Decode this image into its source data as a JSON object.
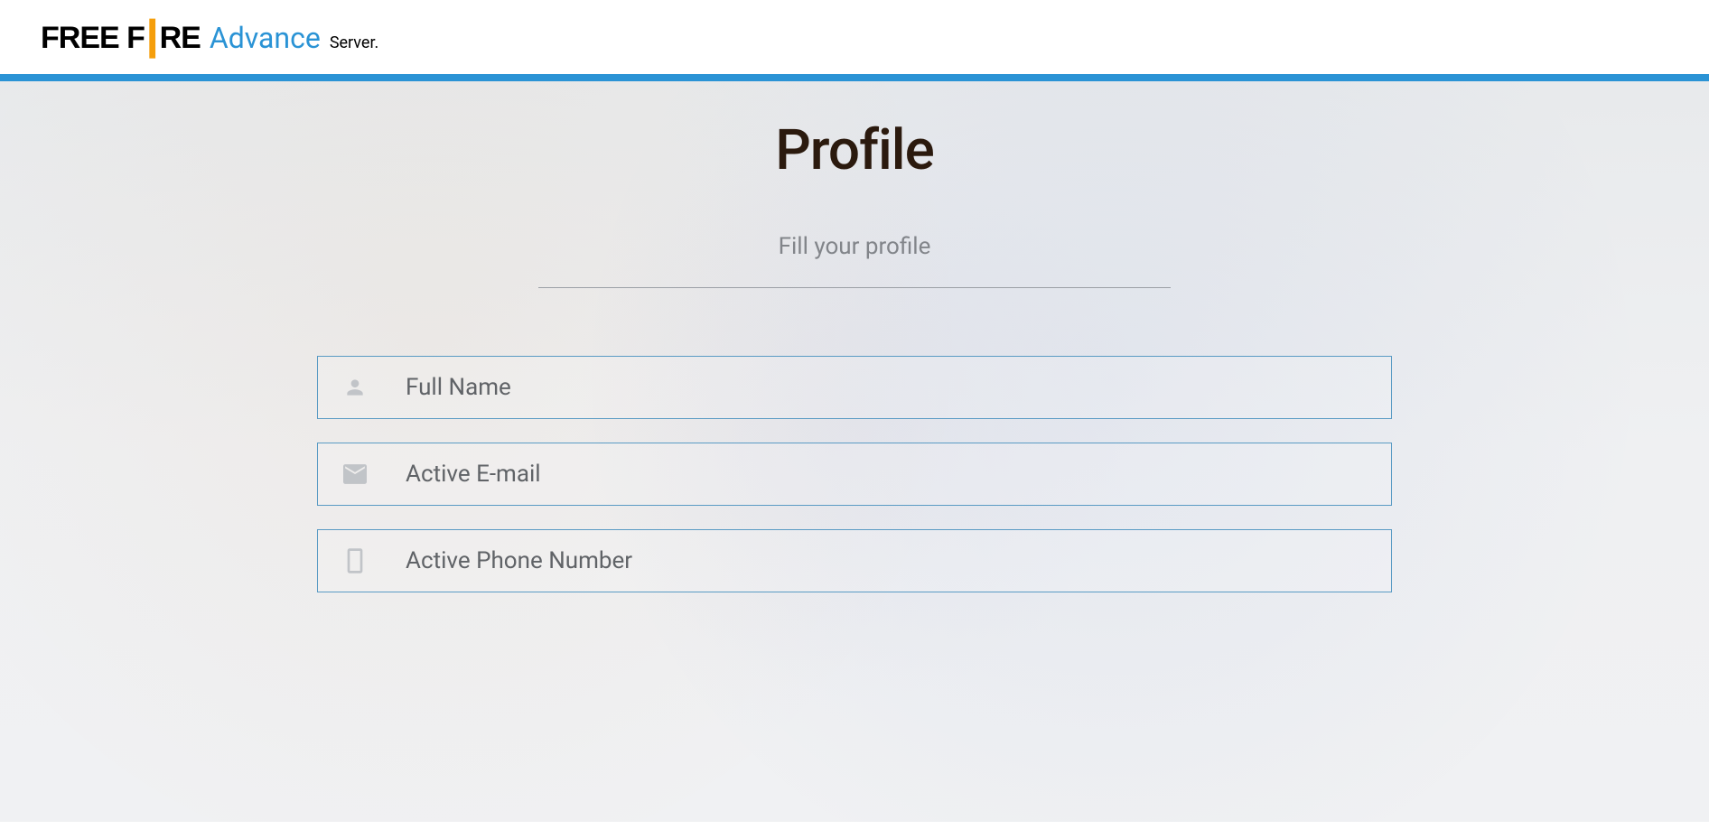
{
  "header": {
    "logo_part1": "FREE F",
    "logo_part2": "RE",
    "logo_advance": "Advance",
    "logo_server": "Server."
  },
  "profile": {
    "title": "Profile",
    "subtitle": "Fill your profile",
    "fields": {
      "fullname": {
        "placeholder": "Full Name",
        "value": ""
      },
      "email": {
        "placeholder": "Active E-mail",
        "value": ""
      },
      "phone": {
        "placeholder": "Active Phone Number",
        "value": ""
      }
    }
  },
  "colors": {
    "accent": "#2A93D5",
    "title": "#2b1a0e",
    "subtitle": "#82858a",
    "icon": "#bfc2c6",
    "border": "#5a9bc4",
    "gold": "#F59E0B"
  }
}
